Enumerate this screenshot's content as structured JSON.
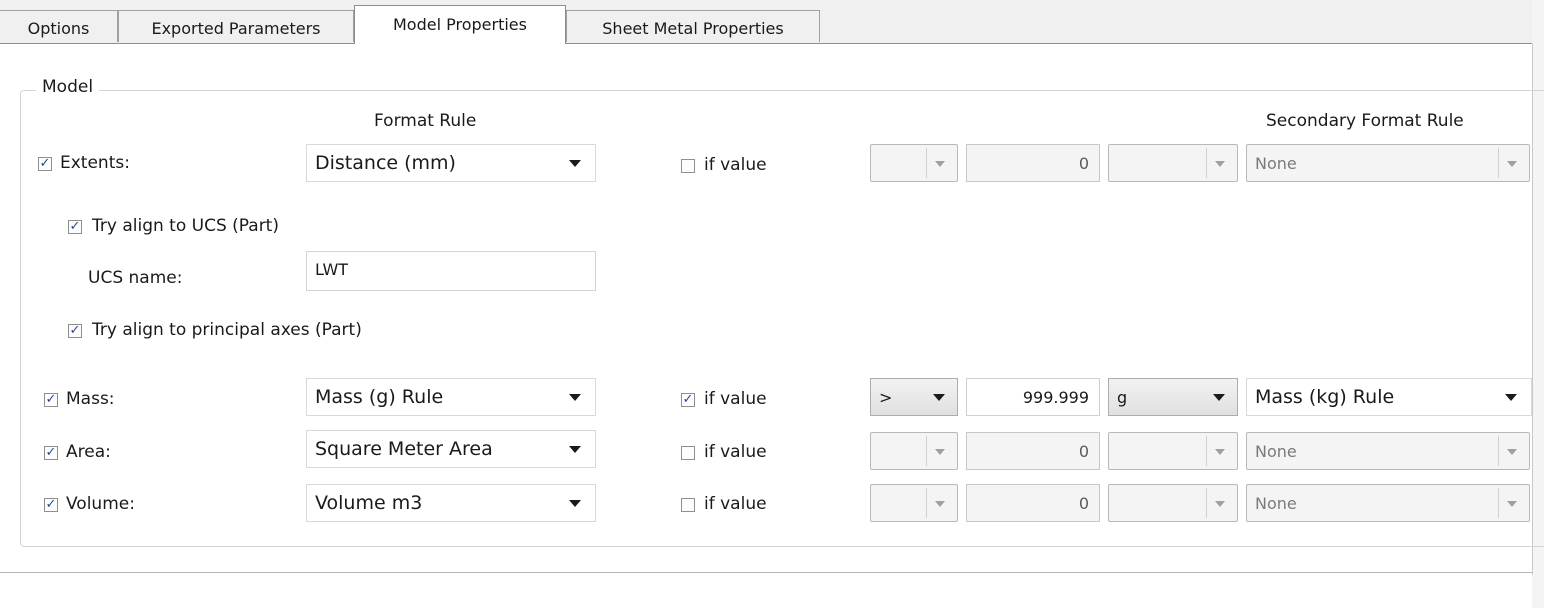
{
  "tabs": [
    {
      "label": "Options",
      "active": false
    },
    {
      "label": "Exported Parameters",
      "active": false
    },
    {
      "label": "Model Properties",
      "active": true
    },
    {
      "label": "Sheet Metal Properties",
      "active": false
    }
  ],
  "group": {
    "title": "Model",
    "format_rule_header": "Format Rule",
    "secondary_format_rule_header": "Secondary Format Rule"
  },
  "extents": {
    "checked": true,
    "label": "Extents:",
    "format_rule": "Distance (mm)",
    "if_value_checked": false,
    "if_value_label": "if value",
    "operator": "",
    "value": "0",
    "unit": "",
    "secondary": "None"
  },
  "align_ucs": {
    "checked": true,
    "label": "Try align to UCS (Part)"
  },
  "ucs_name": {
    "label": "UCS name:",
    "value": "LWT"
  },
  "align_principal": {
    "checked": true,
    "label": "Try align to principal axes (Part)"
  },
  "mass": {
    "checked": true,
    "label": "Mass:",
    "format_rule": "Mass (g) Rule",
    "if_value_checked": true,
    "if_value_label": "if value",
    "operator": ">",
    "value": "999.999",
    "unit": "g",
    "secondary": "Mass (kg) Rule"
  },
  "area": {
    "checked": true,
    "label": "Area:",
    "format_rule": "Square Meter Area",
    "if_value_checked": false,
    "if_value_label": "if value",
    "operator": "",
    "value": "0",
    "unit": "",
    "secondary": "None"
  },
  "volume": {
    "checked": true,
    "label": "Volume:",
    "format_rule": "Volume m3",
    "if_value_checked": false,
    "if_value_label": "if value",
    "operator": "",
    "value": "0",
    "unit": "",
    "secondary": "None"
  },
  "icons": {
    "checkbox_checked": "checkmark-icon",
    "dropdown": "chevron-down-icon"
  },
  "colors": {
    "checkmark": "#2a4a8c",
    "panel_bg": "#ffffff",
    "window_bg": "#f0f0f0"
  }
}
